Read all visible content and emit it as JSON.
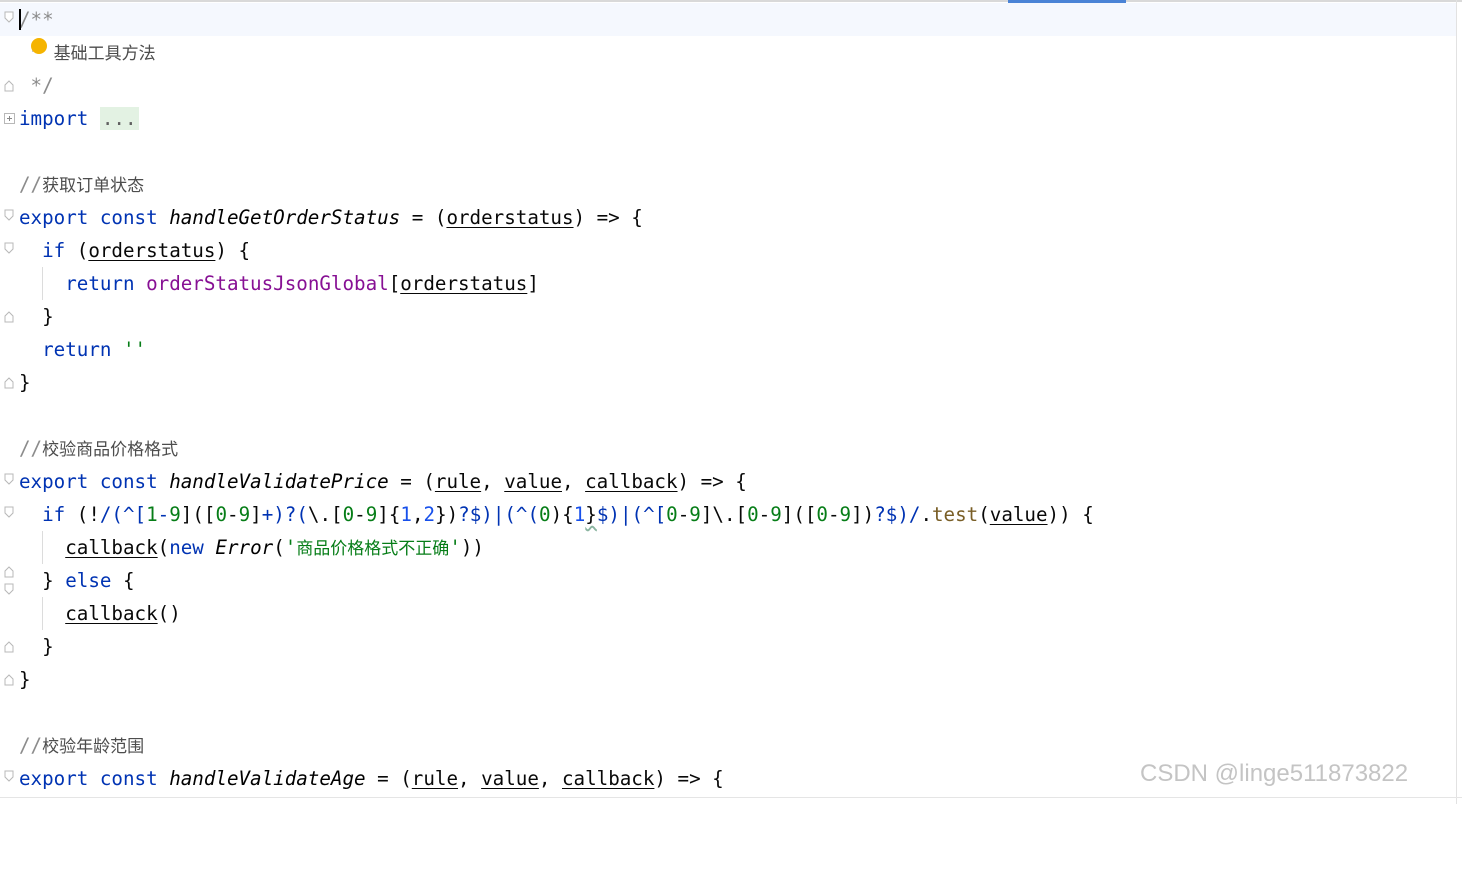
{
  "editor": {
    "lines": [
      {
        "id": "l1",
        "parts": [
          {
            "t": "/**",
            "c": "cmt"
          }
        ]
      },
      {
        "id": "l2",
        "parts": [
          {
            "t": " * ",
            "c": "cmt"
          },
          {
            "t": "基础工具方法",
            "c": "cmt-cjk"
          }
        ]
      },
      {
        "id": "l3",
        "parts": [
          {
            "t": " */",
            "c": "cmt"
          }
        ]
      },
      {
        "id": "l4",
        "parts": [
          {
            "t": "import",
            "c": "kw"
          },
          {
            "t": " "
          },
          {
            "t": "...",
            "c": "folded"
          }
        ]
      },
      {
        "id": "l5",
        "parts": []
      },
      {
        "id": "l6",
        "parts": [
          {
            "t": "//",
            "c": "cmt"
          },
          {
            "t": "获取订单状态",
            "c": "cmt-cjk"
          }
        ]
      },
      {
        "id": "l7",
        "parts": [
          {
            "t": "export const ",
            "c": "kw"
          },
          {
            "t": "handleGetOrderStatus",
            "c": "fn"
          },
          {
            "t": " = ("
          },
          {
            "t": "orderstatus",
            "c": "param"
          },
          {
            "t": ") => {"
          }
        ]
      },
      {
        "id": "l8",
        "parts": [
          {
            "t": "  "
          },
          {
            "t": "if",
            "c": "kw"
          },
          {
            "t": " ("
          },
          {
            "t": "orderstatus",
            "c": "param"
          },
          {
            "t": ") {"
          }
        ]
      },
      {
        "id": "l9",
        "parts": [
          {
            "t": "    "
          },
          {
            "t": "return ",
            "c": "kw"
          },
          {
            "t": "orderStatusJsonGlobal",
            "c": "glob"
          },
          {
            "t": "["
          },
          {
            "t": "orderstatus",
            "c": "param"
          },
          {
            "t": "]"
          }
        ]
      },
      {
        "id": "l10",
        "parts": [
          {
            "t": "  }"
          }
        ]
      },
      {
        "id": "l11",
        "parts": [
          {
            "t": "  "
          },
          {
            "t": "return ",
            "c": "kw"
          },
          {
            "t": "''",
            "c": "str"
          }
        ]
      },
      {
        "id": "l12",
        "parts": [
          {
            "t": "}"
          }
        ]
      },
      {
        "id": "l13",
        "parts": []
      },
      {
        "id": "l14",
        "parts": [
          {
            "t": "//",
            "c": "cmt"
          },
          {
            "t": "校验商品价格格式",
            "c": "cmt-cjk"
          }
        ]
      },
      {
        "id": "l15",
        "parts": [
          {
            "t": "export const ",
            "c": "kw"
          },
          {
            "t": "handleValidatePrice",
            "c": "fn"
          },
          {
            "t": " = ("
          },
          {
            "t": "rule",
            "c": "param"
          },
          {
            "t": ", "
          },
          {
            "t": "value",
            "c": "param"
          },
          {
            "t": ", "
          },
          {
            "t": "callback",
            "c": "param"
          },
          {
            "t": ") => {"
          }
        ]
      },
      {
        "id": "l16",
        "parts": [
          {
            "t": "  "
          },
          {
            "t": "if",
            "c": "kw"
          },
          {
            "t": " (!"
          },
          {
            "t": "/(^[",
            "c": "rx"
          },
          {
            "t": "1",
            "c": "rxd"
          },
          {
            "t": "-",
            "c": "rx"
          },
          {
            "t": "9",
            "c": "rxd"
          },
          {
            "t": "](["
          },
          {
            "t": "0",
            "c": "rxd"
          },
          {
            "t": "-"
          },
          {
            "t": "9",
            "c": "rxd"
          },
          {
            "t": "]"
          },
          {
            "t": "+)?(",
            "c": "rx"
          },
          {
            "t": "\\."
          },
          {
            "t": "["
          },
          {
            "t": "0",
            "c": "rxd"
          },
          {
            "t": "-"
          },
          {
            "t": "9",
            "c": "rxd"
          },
          {
            "t": "]{"
          },
          {
            "t": "1",
            "c": "rxn"
          },
          {
            "t": ","
          },
          {
            "t": "2",
            "c": "rxn"
          },
          {
            "t": "})"
          },
          {
            "t": "?$)|(^(",
            "c": "rx"
          },
          {
            "t": "0",
            "c": "rxd"
          },
          {
            "t": ")"
          },
          {
            "t": "{"
          },
          {
            "t": "1",
            "c": "rxn"
          },
          {
            "t": "}",
            "c": "squig"
          },
          {
            "t": "$)|(^[",
            "c": "rx"
          },
          {
            "t": "0",
            "c": "rxd"
          },
          {
            "t": "-"
          },
          {
            "t": "9",
            "c": "rxd"
          },
          {
            "t": "]\\.["
          },
          {
            "t": "0",
            "c": "rxd"
          },
          {
            "t": "-"
          },
          {
            "t": "9",
            "c": "rxd"
          },
          {
            "t": "](["
          },
          {
            "t": "0",
            "c": "rxd"
          },
          {
            "t": "-"
          },
          {
            "t": "9",
            "c": "rxd"
          },
          {
            "t": "])"
          },
          {
            "t": "?$)/",
            "c": "rx"
          },
          {
            "t": "."
          },
          {
            "t": "test",
            "c": "mth"
          },
          {
            "t": "("
          },
          {
            "t": "value",
            "c": "param"
          },
          {
            "t": ")) {"
          }
        ]
      },
      {
        "id": "l17",
        "parts": [
          {
            "t": "    "
          },
          {
            "t": "callback",
            "c": "param"
          },
          {
            "t": "("
          },
          {
            "t": "new ",
            "c": "kw"
          },
          {
            "t": "Error",
            "c": "fn"
          },
          {
            "t": "("
          },
          {
            "t": "'",
            "c": "str"
          },
          {
            "t": "商品价格格式不正确",
            "c": "str str-cjk"
          },
          {
            "t": "'",
            "c": "str"
          },
          {
            "t": "))"
          }
        ]
      },
      {
        "id": "l18",
        "parts": [
          {
            "t": "  } "
          },
          {
            "t": "else",
            "c": "kw"
          },
          {
            "t": " {"
          }
        ]
      },
      {
        "id": "l19",
        "parts": [
          {
            "t": "    "
          },
          {
            "t": "callback",
            "c": "param"
          },
          {
            "t": "()"
          }
        ]
      },
      {
        "id": "l20",
        "parts": [
          {
            "t": "  }"
          }
        ]
      },
      {
        "id": "l21",
        "parts": [
          {
            "t": "}"
          }
        ]
      },
      {
        "id": "l22",
        "parts": []
      },
      {
        "id": "l23",
        "parts": [
          {
            "t": "//",
            "c": "cmt"
          },
          {
            "t": "校验年龄范围",
            "c": "cmt-cjk"
          }
        ]
      },
      {
        "id": "l24",
        "parts": [
          {
            "t": "export const ",
            "c": "kw"
          },
          {
            "t": "handleValidateAge",
            "c": "fn"
          },
          {
            "t": " = ("
          },
          {
            "t": "rule",
            "c": "param"
          },
          {
            "t": ", "
          },
          {
            "t": "value",
            "c": "param"
          },
          {
            "t": ", "
          },
          {
            "t": "callback",
            "c": "param"
          },
          {
            "t": ") => {"
          }
        ]
      }
    ]
  },
  "watermark": "CSDN @linge511873822"
}
